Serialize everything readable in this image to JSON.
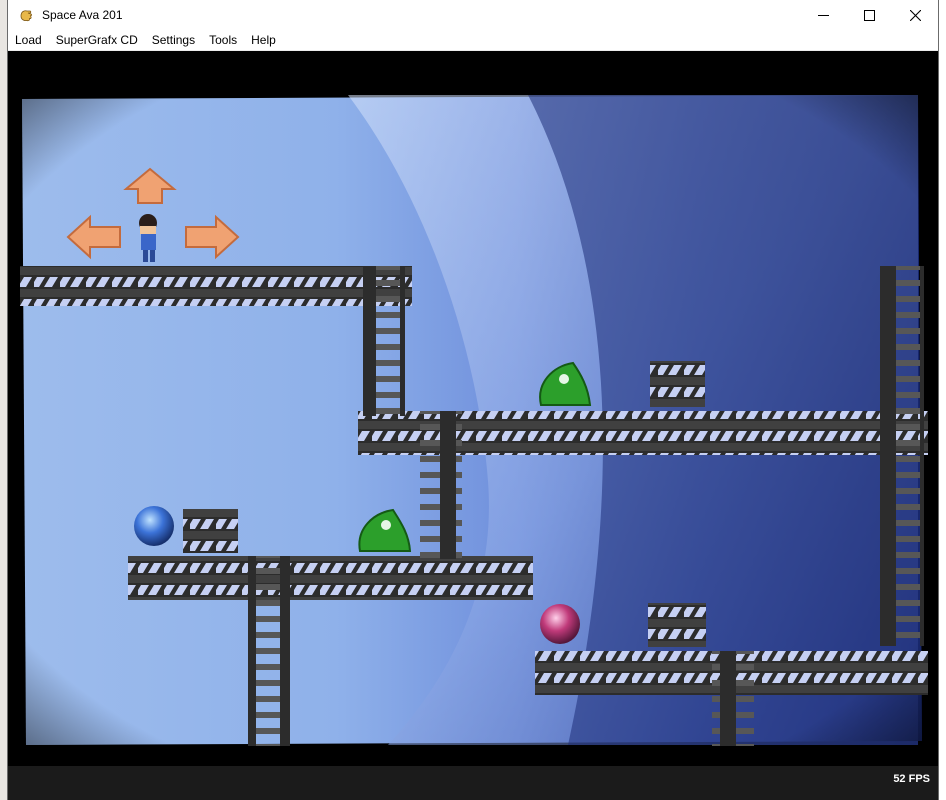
{
  "window": {
    "title": "Space Ava 201",
    "app_icon": "hand-icon",
    "controls": [
      "minimize-icon",
      "maximize-icon",
      "close-icon"
    ]
  },
  "menu": {
    "items": [
      {
        "label": "Load"
      },
      {
        "label": "SuperGrafx CD"
      },
      {
        "label": "Settings"
      },
      {
        "label": "Tools"
      },
      {
        "label": "Help"
      }
    ]
  },
  "status": {
    "fps": "52 FPS"
  },
  "colors": {
    "sky_light": "#9fc0ef",
    "sky_dark": "#1b2f78",
    "girder": "#2b2b2b",
    "girder_light": "#bfc9ee",
    "enemy_green": "#2c9f2b",
    "orb_blue": "#3c73d8",
    "orb_pink": "#c03a7a",
    "arrow_orange": "#f0a272"
  }
}
